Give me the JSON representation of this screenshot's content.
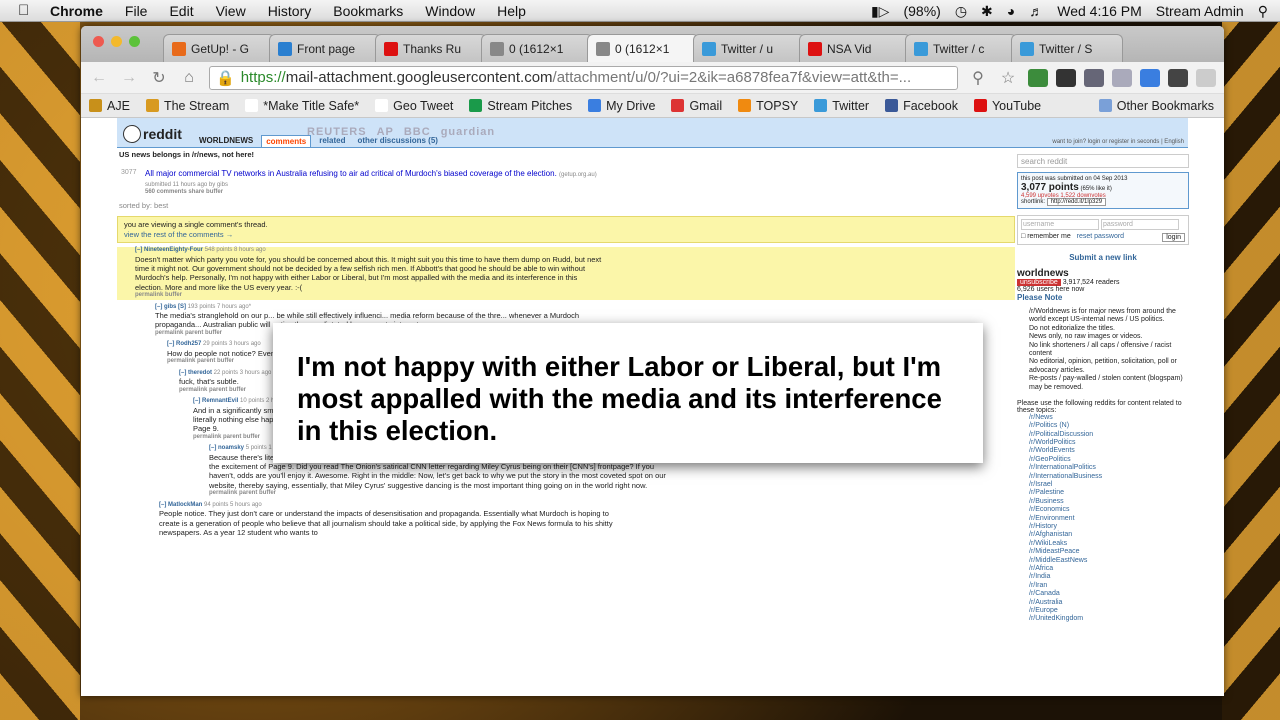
{
  "menubar": {
    "app": "Chrome",
    "items": [
      "File",
      "Edit",
      "View",
      "History",
      "Bookmarks",
      "Window",
      "Help"
    ],
    "battery": "(98%)",
    "clock": "Wed 4:16 PM",
    "user": "Stream Admin"
  },
  "tabs": [
    {
      "label": "GetUp! - G",
      "color": "#e86a1a"
    },
    {
      "label": "Front page",
      "color": "#2a7fd0"
    },
    {
      "label": "Thanks Ru",
      "color": "#d11"
    },
    {
      "label": "0 (1612×1",
      "color": "#888"
    },
    {
      "label": "0 (1612×1",
      "color": "#888",
      "active": true
    },
    {
      "label": "Twitter / u",
      "color": "#3a9ad9"
    },
    {
      "label": "NSA Vid",
      "color": "#d11"
    },
    {
      "label": "Twitter / c",
      "color": "#3a9ad9"
    },
    {
      "label": "Twitter / S",
      "color": "#3a9ad9"
    }
  ],
  "url": {
    "https": "https://",
    "host": "mail-attachment.googleusercontent.com",
    "path": "/attachment/u/0/?ui=2&ik=a6878fea7f&view=att&th=..."
  },
  "bookmarks": [
    {
      "label": "AJE",
      "color": "#c8901a"
    },
    {
      "label": "The Stream",
      "color": "#d89a20"
    },
    {
      "label": "*Make Title Safe*",
      "color": "#fff"
    },
    {
      "label": "Geo Tweet",
      "color": "#fff"
    },
    {
      "label": "Stream Pitches",
      "color": "#1a9a4a"
    },
    {
      "label": "My Drive",
      "color": "#3a7ee0"
    },
    {
      "label": "Gmail",
      "color": "#d33"
    },
    {
      "label": "TOPSY",
      "color": "#f08a10"
    },
    {
      "label": "Twitter",
      "color": "#3a9ad9"
    },
    {
      "label": "Facebook",
      "color": "#3b5998"
    },
    {
      "label": "YouTube",
      "color": "#d11"
    }
  ],
  "bookmarks_other": "Other Bookmarks",
  "reddit": {
    "logo": "reddit",
    "sub": "WORLDNEWS",
    "tabs": [
      "comments",
      "related",
      "other discussions (5)"
    ],
    "notice": "US news belongs in /r/news, not here!",
    "topright": "want to join? login or register in seconds | English",
    "banner": [
      "REUTERS",
      "AP",
      "BBC",
      "guardian"
    ],
    "post": {
      "votes": "3077",
      "title": "All major commercial TV networks in Australia refusing to air ad critical of Murdoch's biased coverage of the election.",
      "domain": "(getup.org.au)",
      "meta": "submitted 11 hours ago by gibs",
      "actions": "560 comments  share  buffer"
    },
    "sort": "sorted by: best",
    "single": "you are viewing a single comment's thread.",
    "viewall": "view the rest of the comments →",
    "comments": [
      {
        "author": "[–] NineteenEighty-Four",
        "meta": "548 points 8 hours ago",
        "text": "Doesn't matter which party you vote for, you should be concerned about this. It might suit you this time to have them dump on Rudd, but next time it might not. Our government should not be decided by a few selfish rich men. If Abbott's that good he should be able to win without Murdoch's help. Personally, I'm not happy with either Labor or Liberal, but I'm most appalled with the media and its interference in this election. More and more like the US every year. :-(",
        "links": "permalink  buffer"
      },
      {
        "author": "[–] gibs [S]",
        "meta": "193 points 7 hours ago*",
        "text": "The media's stranglehold on our p... be while still effectively influenci... media reform because of the thre... whenever a Murdoch propaganda... Australian public will notice the m... dictated by corporate interests.",
        "links": "permalink  parent  buffer"
      },
      {
        "author": "[–] Rodh257",
        "meta": "29 points 3 hours ago",
        "text": "How do people not notice? Even that is missing some an...",
        "links": "permalink  parent  buffer"
      },
      {
        "author": "[–] theredot",
        "meta": "22 points 3 hours ago",
        "text": "fuck, that's subtle.",
        "links": "permalink  parent  buffer"
      },
      {
        "author": "[–] RemnantEvil",
        "meta": "10 points 2 hours ago",
        "text": "And in a significantly smaller print, they have their \"out\" - oh, of course, it's just informing us of an opinion article on Page 9.  Because there's literally nothing else happening in the world that the most important page of the newspaper can be a giant advertisement for the excitement of Page 9.",
        "links": "permalink  parent  buffer"
      },
      {
        "author": "[–] noamsky",
        "meta": "5 points 1 hour ago",
        "text": "Because there's literally nothing else happening in the world that the most important page of the newspaper can be a giant advertisement for the excitement of Page 9.  Did you read The Onion's satirical CNN letter regarding Miley Cyrus being on their [CNN's] frontpage? If you haven't, odds are you'll enjoy it.  Awesome.  Right in the middle:  Now, let's get back to why we put the story in the most coveted spot on our website, thereby saying, essentially, that Miley Cyrus' suggestive dancing is the most important thing going on in the world right now.",
        "links": "permalink  parent  buffer"
      },
      {
        "author": "[–] MatlockMan",
        "meta": "94 points 5 hours ago",
        "text": "People notice. They just don't care or understand the impacts of desensitisation and propaganda.  Essentially what Murdoch is hoping to create is a generation of people who believe that all journalism should take a political side, by applying the Fox News formula to his shitty newspapers. As a year 12 student who wants to",
        "links": ""
      }
    ],
    "sidebar": {
      "search": "search reddit",
      "submitted": "this post was submitted on 04 Sep 2013",
      "points": "3,077 points",
      "liked": "(65% like it)",
      "votes": "4,599 upvotes  1,522 downvotes",
      "shortlink_label": "shortlink:",
      "shortlink": "http://redd.it/1lp329",
      "username": "username",
      "password": "password",
      "remember": "remember me",
      "reset": "reset password",
      "login": "login",
      "submit": "Submit a new link",
      "subname": "worldnews",
      "unsubscribe": "unsubscribe",
      "readers": "3,917,524 readers",
      "online": "6,926 users here now",
      "note": "Please Note",
      "rules": [
        "/r/Worldnews is for major news from around the world except US-internal news / US politics.",
        "Do not editorialize the titles.",
        "News only, no raw images or videos.",
        "No link shorteners / all caps / offensive / racist content",
        "No editorial, opinion, petition, solicitation, poll or advocacy articles.",
        "Re-posts / pay-walled / stolen content (blogspam) may be removed."
      ],
      "related_intro": "Please use the following reddits for content related to these topics:",
      "links": [
        "/r/News",
        "/r/Politics (N)",
        "/r/PoliticalDiscussion",
        "/r/WorldPolitics",
        "/r/WorldEvents",
        "/r/GeoPolitics",
        "/r/InternationalPolitics",
        "/r/InternationalBusiness",
        "/r/Israel",
        "/r/Palestine",
        "/r/Business",
        "/r/Economics",
        "/r/Environment",
        "/r/History",
        "/r/Afghanistan",
        "/r/WikiLeaks",
        "/r/MideastPeace",
        "/r/MiddleEastNews",
        "/r/Africa",
        "/r/India",
        "/r/Iran",
        "/r/Canada",
        "/r/Australia",
        "/r/Europe",
        "/r/UnitedKingdom"
      ]
    }
  },
  "overlay": "I'm not happy with either Labor or Liberal, but I'm most appalled with the media and its interference in this election."
}
